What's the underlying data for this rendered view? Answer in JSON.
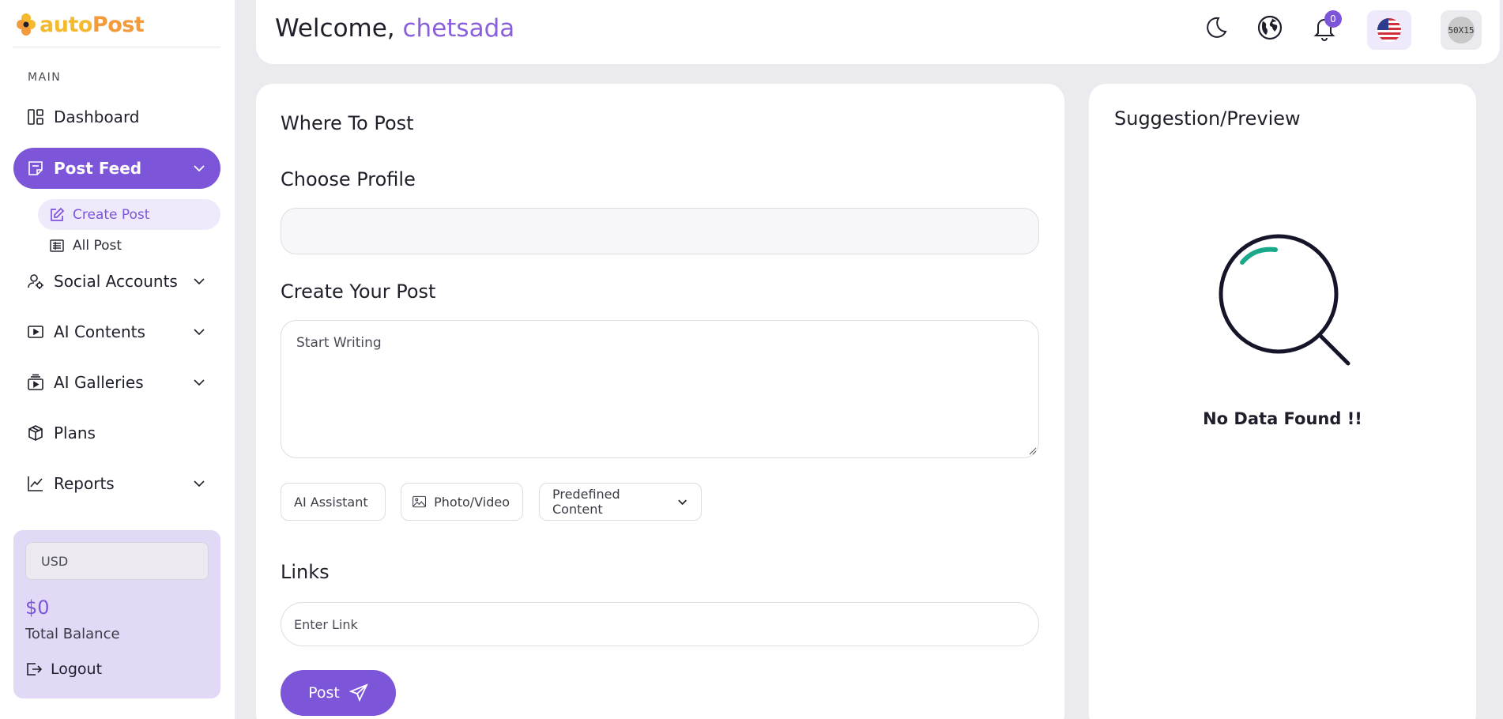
{
  "brand": {
    "part1": "auto",
    "part2": "Post"
  },
  "sidebar": {
    "section_label": "MAIN",
    "items": [
      {
        "label": "Dashboard",
        "icon": "dashboard-icon"
      },
      {
        "label": "Post Feed",
        "icon": "post-feed-icon",
        "active": true
      },
      {
        "label": "Social Accounts",
        "icon": "social-accounts-icon"
      },
      {
        "label": "AI Contents",
        "icon": "ai-contents-icon"
      },
      {
        "label": "AI Galleries",
        "icon": "ai-galleries-icon"
      },
      {
        "label": "Plans",
        "icon": "plans-icon"
      },
      {
        "label": "Reports",
        "icon": "reports-icon"
      }
    ],
    "sub_items": [
      {
        "label": "Create Post",
        "icon": "edit-icon",
        "active": true
      },
      {
        "label": "All Post",
        "icon": "list-icon"
      }
    ],
    "balance": {
      "currency": "USD",
      "amount": "$0",
      "label": "Total Balance",
      "logout_label": "Logout"
    }
  },
  "header": {
    "welcome_prefix": "Welcome,",
    "username": "chetsada",
    "notification_count": "0",
    "avatar_text": "50X15"
  },
  "main": {
    "where_title": "Where To Post",
    "choose_profile_label": "Choose Profile",
    "create_post_label": "Create Your Post",
    "post_placeholder": "Start Writing",
    "tools": {
      "ai_assistant": "AI Assistant",
      "photo_video": "Photo/Video",
      "predefined": "Predefined Content"
    },
    "links_label": "Links",
    "link_placeholder": "Enter Link",
    "post_button": "Post"
  },
  "side": {
    "title": "Suggestion/Preview",
    "empty_text": "No Data Found !!"
  },
  "colors": {
    "accent": "#7d55d9",
    "accent_light": "#efe9fc",
    "background": "#ebebef",
    "logo_yellow": "#f5b92e",
    "logo_orange": "#f39a3a",
    "illustration_green": "#1aa88a"
  }
}
